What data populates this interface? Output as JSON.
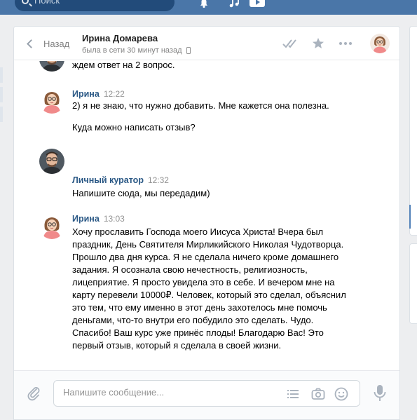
{
  "topbar": {
    "search_placeholder": "Поиск",
    "icons": [
      "bell-icon",
      "music-icon",
      "play-icon"
    ]
  },
  "header": {
    "back_label": "Назад",
    "peer_name": "Ирина Домарева",
    "peer_status": "была в сети 30 минут назад",
    "icons": [
      "double-check-icon",
      "star-icon",
      "more-icon",
      "avatar"
    ]
  },
  "messages": [
    {
      "author": "",
      "time": "",
      "lines": [
        "ждем ответ на 2 вопрос."
      ]
    },
    {
      "author": "Ирина",
      "time": "12:22",
      "lines": [
        "2) я не знаю, что нужно добавить. Мне кажется она полезна.",
        "Куда можно написать отзыв?"
      ]
    },
    {
      "author": "Личный куратор",
      "time": "12:32",
      "lines": [
        "Напишите сюда, мы передадим)"
      ]
    },
    {
      "author": "Ирина",
      "time": "13:03",
      "lines": [
        "Хочу прославить Господа моего Иисуса Христа! Вчера был праздник, День Святителя Мирликийского Николая Чудотворца. Прошло два дня курса. Я не сделала ничего кроме домашнего задания. Я осознала свою нечестность, религиозность, лицеприятие. Я просто увидела это в себе. И вечером мне на карту перевели 10000₽. Человек, который это сделал, объяснил это тем, что ему именно в этот день захотелось мне помочь деньгами, что-то внутри его побудило это сделать. Чудо. Спасибо! Ваш курс уже принёс плоды! Благодарю Вас! Это первый отзыв, который я сделала в своей жизни."
      ]
    }
  ],
  "composer": {
    "placeholder": "Напишите сообщение...",
    "icons": [
      "attach-icon",
      "list-icon",
      "camera-icon",
      "smile-icon",
      "mic-icon"
    ]
  },
  "colors": {
    "accent": "#4a76a8",
    "author_link": "#2a5885",
    "muted": "#939393"
  }
}
